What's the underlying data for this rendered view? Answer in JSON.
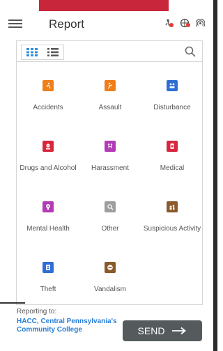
{
  "app_bar": {
    "title": "Report"
  },
  "panel": {
    "view_modes": [
      "grid",
      "list"
    ],
    "categories": [
      {
        "label": "Accidents",
        "icon": "accident-icon",
        "color": "#f07e1b"
      },
      {
        "label": "Assault",
        "icon": "assault-icon",
        "color": "#f07e1b"
      },
      {
        "label": "Disturbance",
        "icon": "disturbance-icon",
        "color": "#2f6fd4"
      },
      {
        "label": "Drugs and Alcohol",
        "icon": "drugs-icon",
        "color": "#d7263d"
      },
      {
        "label": "Harassment",
        "icon": "harassment-icon",
        "color": "#b33bb6"
      },
      {
        "label": "Medical",
        "icon": "medical-icon",
        "color": "#d7263d"
      },
      {
        "label": "Mental Health",
        "icon": "mental-health-icon",
        "color": "#b33bb6"
      },
      {
        "label": "Other",
        "icon": "other-icon",
        "color": "#9e9e9e"
      },
      {
        "label": "Suspicious Activity",
        "icon": "suspicious-icon",
        "color": "#8a5a2b"
      },
      {
        "label": "Theft",
        "icon": "theft-icon",
        "color": "#2f6fd4"
      },
      {
        "label": "Vandalism",
        "icon": "vandalism-icon",
        "color": "#8a5a2b"
      }
    ]
  },
  "footer": {
    "reporting_to_label": "Reporting to:",
    "organization": "HACC, Central Pennsylvania's Community College",
    "send_label": "SEND"
  },
  "colors": {
    "accent_red": "#c8263a",
    "link_blue": "#2a7fd8",
    "send_button": "#555b5d"
  }
}
